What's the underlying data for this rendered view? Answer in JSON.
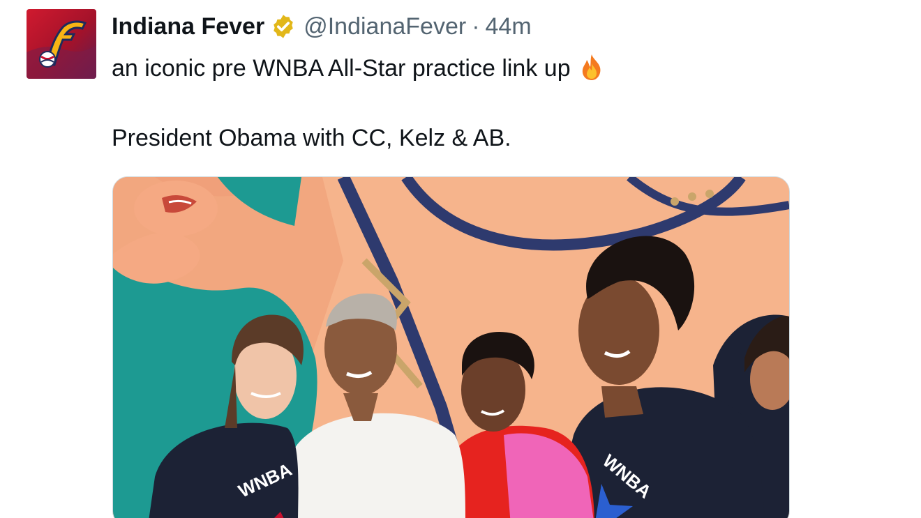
{
  "author": {
    "display_name": "Indiana Fever",
    "handle": "@IndianaFever",
    "separator": "·",
    "timestamp": "44m",
    "verified": true,
    "verified_color": "#e2b719",
    "avatar_icon": "indiana-fever-logo-icon",
    "avatar_colors": [
      "#c8102e",
      "#1d2b5c",
      "#f8b514"
    ]
  },
  "tweet": {
    "line1": "an iconic pre WNBA All-Star practice link up",
    "emoji": "fire-icon",
    "line2": "President Obama with CC, Kelz & AB."
  },
  "media": {
    "type": "photo",
    "jersey_text": "WNBA"
  },
  "colors": {
    "text_primary": "#0f1419",
    "text_secondary": "#536471",
    "border": "#cfd9de"
  }
}
